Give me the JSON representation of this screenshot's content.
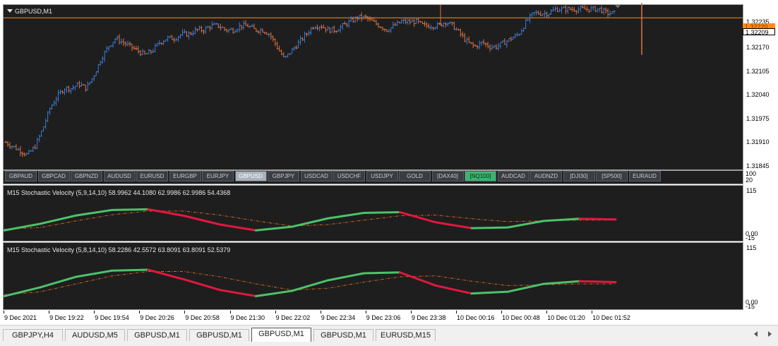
{
  "window": {
    "title": "GBPUSD,M1"
  },
  "price_axis": {
    "labels": [
      "1.32235",
      "1.32170",
      "1.32105",
      "1.32040",
      "1.31975",
      "1.31910",
      "1.31845"
    ],
    "current_bid": "1.32209",
    "current_ask": "1.32220"
  },
  "symbol_buttons": [
    {
      "label": "GBPAUD",
      "state": "normal"
    },
    {
      "label": "GBPCAD",
      "state": "normal"
    },
    {
      "label": "GBPNZD",
      "state": "normal"
    },
    {
      "label": "AUDUSD",
      "state": "normal"
    },
    {
      "label": "EURUSD",
      "state": "normal"
    },
    {
      "label": "EURGBP",
      "state": "normal"
    },
    {
      "label": "EURJPY",
      "state": "normal"
    },
    {
      "label": "GBPUSD",
      "state": "active"
    },
    {
      "label": "GBPJPY",
      "state": "normal"
    },
    {
      "label": "USDCAD",
      "state": "normal"
    },
    {
      "label": "USDCHF",
      "state": "normal"
    },
    {
      "label": "USDJPY",
      "state": "normal"
    },
    {
      "label": "GOLD",
      "state": "normal"
    },
    {
      "label": "[DAX40]",
      "state": "normal"
    },
    {
      "label": "[NQ100]",
      "state": "green"
    },
    {
      "label": "AUDCAD",
      "state": "normal"
    },
    {
      "label": "AUDNZD",
      "state": "normal"
    },
    {
      "label": "[DJI30]",
      "state": "normal"
    },
    {
      "label": "[SP500]",
      "state": "normal"
    },
    {
      "label": "EURAUD",
      "state": "normal"
    }
  ],
  "strip_axis": {
    "top": "100",
    "bottom": "20"
  },
  "indicator1": {
    "title": "M15   Stochastic Velocity (5,9,14,10) 58.9962 44.1080 62.9986 62.9986 54.4368",
    "axis_top": "115",
    "axis_bottom": "0.00",
    "axis_bottom2": "-15"
  },
  "indicator2": {
    "title": "M15   Stochastic Velocity (5,8,14,10) 58.2286 42.5572 63.8091 63.8091 52.5379",
    "axis_top": "115",
    "axis_bottom": "0.00",
    "axis_bottom2": "-15"
  },
  "time_axis": [
    "9 Dec 2021",
    "9 Dec 19:22",
    "9 Dec 19:54",
    "9 Dec 20:26",
    "9 Dec 20:58",
    "9 Dec 21:30",
    "9 Dec 22:02",
    "9 Dec 22:34",
    "9 Dec 23:06",
    "9 Dec 23:38",
    "10 Dec 00:16",
    "10 Dec 00:48",
    "10 Dec 01:20",
    "10 Dec 01:52"
  ],
  "chart_tabs": [
    {
      "label": "GBPJPY,H4",
      "active": false
    },
    {
      "label": "AUDUSD,M5",
      "active": false
    },
    {
      "label": "GBPUSD,M1",
      "active": false
    },
    {
      "label": "GBPUSD,M1",
      "active": false
    },
    {
      "label": "GBPUSD,M1",
      "active": true
    },
    {
      "label": "GBPUSD,M1",
      "active": false
    },
    {
      "label": "EURUSD,M15",
      "active": false
    }
  ],
  "colors": {
    "background": "#1e1e1e",
    "bull_bar": "#3a7bd5",
    "bear_bar": "#e07040",
    "price_line": "#ff8c1a",
    "rising": "#4cc26a",
    "falling": "#e3173e",
    "signal": "#d2691e"
  },
  "chart_data": [
    {
      "type": "bar",
      "title": "GBPUSD,M1",
      "xlabel": "",
      "ylabel": "",
      "ylim": [
        1.31845,
        1.3224
      ],
      "x_ticks": [
        "9 Dec 2021",
        "9 Dec 19:22",
        "9 Dec 19:54",
        "9 Dec 20:26",
        "9 Dec 20:58",
        "9 Dec 21:30",
        "9 Dec 22:02",
        "9 Dec 22:34",
        "9 Dec 23:06",
        "9 Dec 23:38",
        "10 Dec 00:16",
        "10 Dec 00:48",
        "10 Dec 01:20",
        "10 Dec 01:52"
      ],
      "y_ticks": [
        1.32235,
        1.3217,
        1.32105,
        1.3204,
        1.31975,
        1.3191,
        1.31845
      ],
      "current_price": 1.32209,
      "series": [
        {
          "name": "GBPUSD",
          "close_path": [
            1.3191,
            1.319,
            1.3189,
            1.3188,
            1.319,
            1.3194,
            1.3199,
            1.3202,
            1.3204,
            1.3204,
            1.3205,
            1.3204,
            1.3207,
            1.3211,
            1.3214,
            1.3216,
            1.3215,
            1.3214,
            1.3213,
            1.3212,
            1.3213,
            1.3215,
            1.3216,
            1.3216,
            1.3217,
            1.3217,
            1.3218,
            1.3218,
            1.3219,
            1.3219,
            1.3218,
            1.3218,
            1.3219,
            1.3219,
            1.3218,
            1.3218,
            1.3217,
            1.3214,
            1.3211,
            1.3213,
            1.3215,
            1.3217,
            1.3219,
            1.3219,
            1.3218,
            1.3218,
            1.3219,
            1.322,
            1.3221,
            1.3221,
            1.322,
            1.3219,
            1.3218,
            1.3219,
            1.322,
            1.322,
            1.322,
            1.3219,
            1.3219,
            1.3219,
            1.322,
            1.3219,
            1.3217,
            1.3215,
            1.3214,
            1.3215,
            1.3214,
            1.3214,
            1.3215,
            1.3216,
            1.3217,
            1.322,
            1.3222,
            1.3222,
            1.3222,
            1.3223,
            1.3223,
            1.3223,
            1.3223,
            1.3223,
            1.3223,
            1.3223,
            1.3222,
            1.3222
          ]
        }
      ]
    },
    {
      "type": "line",
      "title": "M15   Stochastic Velocity (5,9,14,10) 58.9962 44.1080 62.9986 62.9986 54.4368",
      "xlabel": "",
      "ylabel": "",
      "ylim": [
        -15,
        115
      ],
      "series": [
        {
          "name": "",
          "values": [
            2,
            20,
            43,
            58,
            60,
            42,
            18,
            2,
            12,
            35,
            50,
            52,
            24,
            8,
            10,
            28,
            34,
            32
          ]
        },
        {
          "name": "",
          "values": [
            5,
            10,
            28,
            45,
            55,
            55,
            44,
            28,
            14,
            18,
            30,
            42,
            44,
            34,
            26,
            28,
            30,
            30
          ]
        }
      ]
    },
    {
      "type": "line",
      "title": "M15   Stochastic Velocity (5,8,14,10) 58.2286 42.5572 63.8091 63.8091 52.5379",
      "xlabel": "",
      "ylabel": "",
      "ylim": [
        -15,
        115
      ],
      "series": [
        {
          "name": "",
          "values": [
            2,
            22,
            46,
            60,
            62,
            40,
            16,
            2,
            14,
            38,
            54,
            56,
            26,
            8,
            12,
            30,
            36,
            34
          ]
        },
        {
          "name": "",
          "values": [
            5,
            12,
            30,
            48,
            58,
            58,
            46,
            30,
            16,
            20,
            34,
            46,
            48,
            36,
            26,
            28,
            30,
            30
          ]
        }
      ]
    }
  ]
}
